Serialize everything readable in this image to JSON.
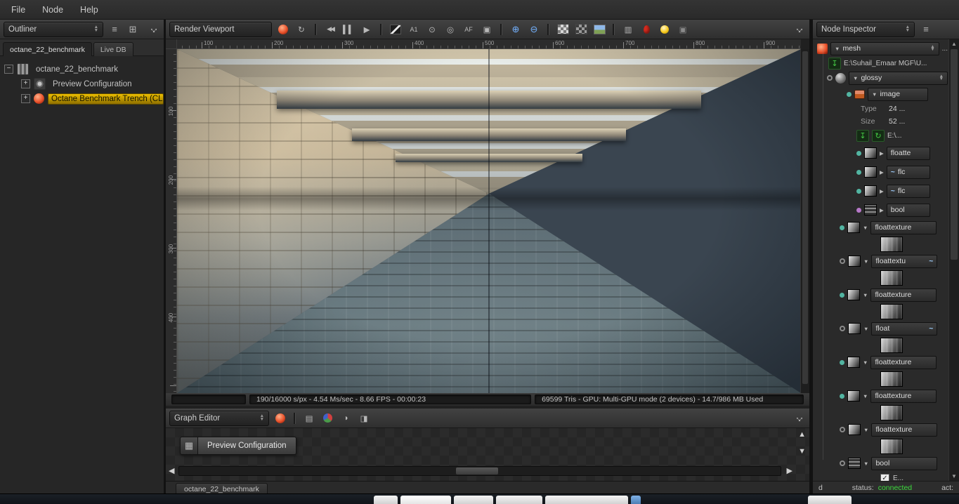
{
  "menu": {
    "items": [
      {
        "label": "File",
        "name": "menu-file"
      },
      {
        "label": "Node",
        "name": "menu-node"
      },
      {
        "label": "Help",
        "name": "menu-help"
      }
    ]
  },
  "icons": {
    "tri_down": "▼",
    "tri_up": "▲",
    "tri_right": "▶",
    "list": "≡",
    "grid": "⊞",
    "menu": "≡",
    "curve": "~",
    "check": "✓",
    "arrow_left": "◀",
    "arrow_right": "▶",
    "arrow_up": "▲",
    "arrow_down": "▼",
    "node_glyph": "▦",
    "import": "↧",
    "refresh": "↻"
  },
  "colors": {
    "selection_gold": "#ecbe00",
    "status_connected_green": "#3ddc3d",
    "pin_teal": "#52b5a2",
    "pin_purple": "#b678c8",
    "octane_logo_red": "#e8512a",
    "zoom_icon_blue": "#74b2ff",
    "green_icon": "#45c945"
  },
  "outliner": {
    "title": "Outliner",
    "tabs": [
      {
        "label": "octane_22_benchmark",
        "cls": "active"
      },
      {
        "label": "Live DB",
        "cls": ""
      }
    ],
    "tree": [
      {
        "label": "octane_22_benchmark",
        "expander": "−",
        "iconcls": "i-nodegraph",
        "iconname": "node-graph-icon",
        "rowcls": "ind0",
        "labelcls": ""
      },
      {
        "label": "Preview Configuration",
        "expander": "+",
        "iconcls": "i-config",
        "iconname": "preview-config-icon",
        "rowcls": "ind1",
        "labelcls": ""
      },
      {
        "label": "Octane Benchmark Trench (CLIC",
        "expander": "+",
        "iconcls": "i-logo",
        "iconname": "octane-node-icon",
        "rowcls": "ind1",
        "labelcls": "sel"
      }
    ]
  },
  "viewport": {
    "title": "Render Viewport",
    "toolbar": [
      {
        "name": "octane-logo-icon",
        "glyph": "",
        "cls": "i-logo-t"
      },
      {
        "name": "refresh-render-icon",
        "glyph": "↻",
        "cls": ""
      },
      {
        "name": "toolbar-separator",
        "glyph": "",
        "cls": "tsep",
        "inter": "false"
      },
      {
        "name": "restart-render-icon",
        "glyph": "◀◀",
        "cls": "i-sm"
      },
      {
        "name": "pause-render-icon",
        "glyph": "▍▍",
        "cls": "i-pause"
      },
      {
        "name": "play-render-icon",
        "glyph": "▶",
        "cls": ""
      },
      {
        "name": "toolbar-separator",
        "glyph": "",
        "cls": "tsep",
        "inter": "false"
      },
      {
        "name": "region-render-icon",
        "glyph": "",
        "cls": "i-diag"
      },
      {
        "name": "subsample-icon",
        "glyph": "A1",
        "cls": "i-sm2"
      },
      {
        "name": "clay-mode-icon",
        "glyph": "⊙",
        "cls": ""
      },
      {
        "name": "focus-picker-icon",
        "glyph": "◎",
        "cls": ""
      },
      {
        "name": "autofocus-icon",
        "glyph": "AF",
        "cls": "i-sm2"
      },
      {
        "name": "camera-lock-icon",
        "glyph": "▣",
        "cls": ""
      },
      {
        "name": "toolbar-separator",
        "glyph": "",
        "cls": "tsep",
        "inter": "false"
      },
      {
        "name": "zoom-in-icon",
        "glyph": "⊕",
        "cls": "i-blue"
      },
      {
        "name": "zoom-out-icon",
        "glyph": "⊖",
        "cls": "i-blue"
      },
      {
        "name": "toolbar-separator",
        "glyph": "",
        "cls": "tsep",
        "inter": "false"
      },
      {
        "name": "checker-background-icon",
        "glyph": "",
        "cls": "i-checker"
      },
      {
        "name": "checker-background-alt-icon",
        "glyph": "",
        "cls": "i-checker2"
      },
      {
        "name": "background-image-icon",
        "glyph": "",
        "cls": "i-imgpic"
      },
      {
        "name": "toolbar-separator",
        "glyph": "",
        "cls": "tsep",
        "inter": "false"
      },
      {
        "name": "copy-render-icon",
        "glyph": "▥",
        "cls": ""
      },
      {
        "name": "material-picker-icon",
        "glyph": "",
        "cls": "i-reddrop"
      },
      {
        "name": "light-picker-icon",
        "glyph": "",
        "cls": "i-bulb"
      },
      {
        "name": "ui-lock-icon",
        "glyph": "▣",
        "cls": "i-dim"
      }
    ],
    "ruler_h": [
      "100",
      "200",
      "300",
      "400",
      "500",
      "600",
      "700",
      "800",
      "900"
    ],
    "ruler_v": [
      "100",
      "200",
      "300",
      "400"
    ],
    "status_left": "190/16000 s/px - 4.54 Ms/sec - 8.66 FPS - 00:00:23",
    "status_right": "69599 Tris - GPU: Multi-GPU mode (2 devices) - 14.7/986 MB Used"
  },
  "graph_editor": {
    "title": "Graph Editor",
    "toolbar": [
      {
        "name": "octane-logo-icon",
        "glyph": "",
        "cls": "i-logo-t"
      },
      {
        "name": "toolbar-separator",
        "glyph": "",
        "cls": "tsep",
        "inter": "false"
      },
      {
        "name": "add-node-icon",
        "glyph": "▤",
        "cls": ""
      },
      {
        "name": "material-preview-icon",
        "glyph": "",
        "cls": "i-ball"
      },
      {
        "name": "environment-preview-icon",
        "glyph": "◑",
        "cls": ""
      },
      {
        "name": "export-graph-icon",
        "glyph": "◨",
        "cls": ""
      }
    ],
    "node_label": "Preview Configuration",
    "tab": "octane_22_benchmark"
  },
  "inspector": {
    "title": "Node Inspector",
    "mesh_label": "mesh",
    "mesh_more": "...",
    "mesh_path": "E:\\Suhail_Emaar MGF\\U...",
    "material_label": "glossy",
    "image_label": "image",
    "type_label": "Type",
    "type_value": "24 ...",
    "size_label": "Size",
    "size_value": "52 ...",
    "image_path": "E:\\...",
    "small_nodes": [
      {
        "label": "floatte",
        "pin": "pin-teal",
        "thumbcls": "t-grad",
        "curvecls": "hide"
      },
      {
        "label": "flc",
        "pin": "pin-teal",
        "thumbcls": "t-grad",
        "curvecls": "show"
      },
      {
        "label": "flc",
        "pin": "pin-teal",
        "thumbcls": "t-grad",
        "curvecls": "show"
      },
      {
        "label": "bool",
        "pin": "pin-purple",
        "thumbcls": "t-bool",
        "curvecls": "hide"
      }
    ],
    "texture_nodes": [
      {
        "label": "floattexture",
        "pin": "pin-teal",
        "curvecls": "hide"
      },
      {
        "label": "floattextu",
        "pin": "pin-hollow",
        "curvecls": "show"
      },
      {
        "label": "floattexture",
        "pin": "pin-teal",
        "curvecls": "hide"
      },
      {
        "label": "float",
        "pin": "pin-hollow",
        "curvecls": "show"
      },
      {
        "label": "floattexture",
        "pin": "pin-teal",
        "curvecls": "hide"
      },
      {
        "label": "floattexture",
        "pin": "pin-teal",
        "curvecls": "hide"
      },
      {
        "label": "floattexture",
        "pin": "pin-hollow",
        "curvecls": "hide"
      }
    ],
    "bool_label": "bool",
    "bool_value": "E...",
    "bool_pin": "pin-hollow"
  },
  "statusbar": {
    "fragment": "d",
    "status_label": "status:",
    "status_value": "connected",
    "act_label": "act:"
  }
}
